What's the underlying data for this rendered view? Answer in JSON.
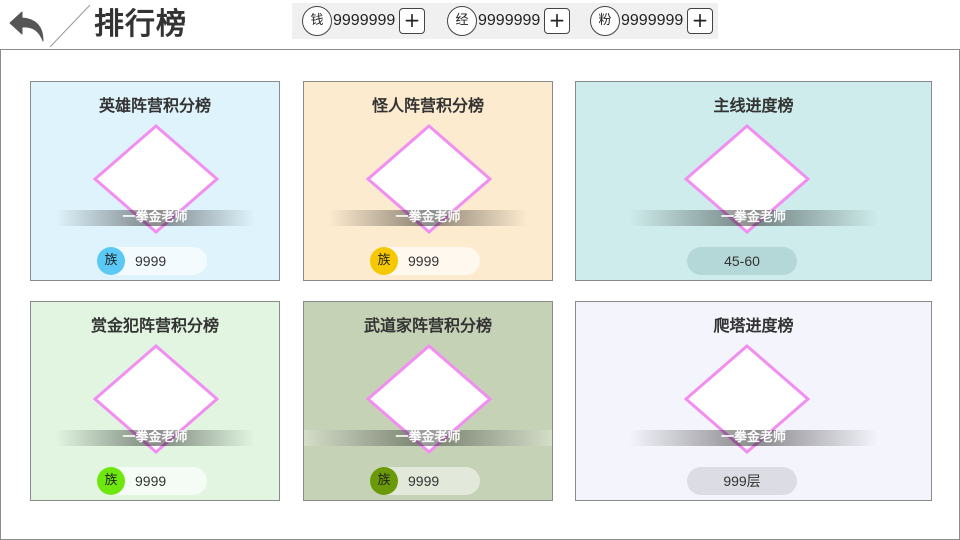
{
  "header": {
    "title": "排行榜",
    "back_icon": "back-arrow-icon"
  },
  "currencies": [
    {
      "icon_label": "钱",
      "value": "9999999",
      "add_label": "+"
    },
    {
      "icon_label": "经",
      "value": "9999999",
      "add_label": "+"
    },
    {
      "icon_label": "粉",
      "value": "9999999",
      "add_label": "+"
    }
  ],
  "cards": [
    {
      "title": "英雄阵营积分榜",
      "name": "一拳金老师",
      "clan_label": "族",
      "score": "9999",
      "bg_color": "#dff3fc",
      "clan_color": "#5bc8f5"
    },
    {
      "title": "怪人阵营积分榜",
      "name": "一拳金老师",
      "clan_label": "族",
      "score": "9999",
      "bg_color": "#fdebcf",
      "clan_color": "#f5c800"
    },
    {
      "title": "主线进度榜",
      "name": "一拳金老师",
      "range": "45-60",
      "bg_color": "#cdeceb"
    },
    {
      "title": "赏金犯阵营积分榜",
      "name": "一拳金老师",
      "clan_label": "族",
      "score": "9999",
      "bg_color": "#e1f5e1",
      "clan_color": "#6ee80c"
    },
    {
      "title": "武道家阵营积分榜",
      "name": "一拳金老师",
      "clan_label": "族",
      "score": "9999",
      "bg_color": "#c5d2b5",
      "clan_color": "#6a9a0a"
    },
    {
      "title": "爬塔进度榜",
      "name": "一拳金老师",
      "range": "999层",
      "bg_color": "#f4f4fc"
    }
  ],
  "colors": {
    "diamond_border": "#f28ef2",
    "border": "#8c8c8c"
  }
}
